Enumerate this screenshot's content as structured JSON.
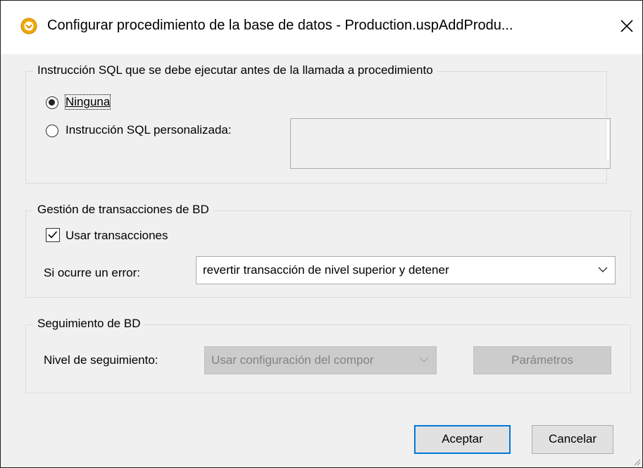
{
  "window": {
    "title": "Configurar procedimiento de la base de datos - Production.uspAddProdu...",
    "close_label": "✕"
  },
  "sql_group": {
    "legend": "Instrucción SQL que se debe ejecutar antes de la llamada a procedimiento",
    "options": [
      {
        "label": "Ninguna",
        "selected": true
      },
      {
        "label": "Instrucción SQL personalizada:",
        "selected": false
      }
    ],
    "custom_sql_value": ""
  },
  "transactions_group": {
    "legend": "Gestión de transacciones de BD",
    "use_transactions_label": "Usar transacciones",
    "use_transactions_checked": true,
    "on_error_label": "Si ocurre un error:",
    "on_error_value": "revertir transacción de nivel superior y detener"
  },
  "trace_group": {
    "legend": "Seguimiento de BD",
    "trace_level_label": "Nivel de seguimiento:",
    "trace_level_value": "Usar configuración del compor",
    "parameters_label": "Parámetros"
  },
  "footer": {
    "ok_label": "Aceptar",
    "cancel_label": "Cancelar"
  }
}
